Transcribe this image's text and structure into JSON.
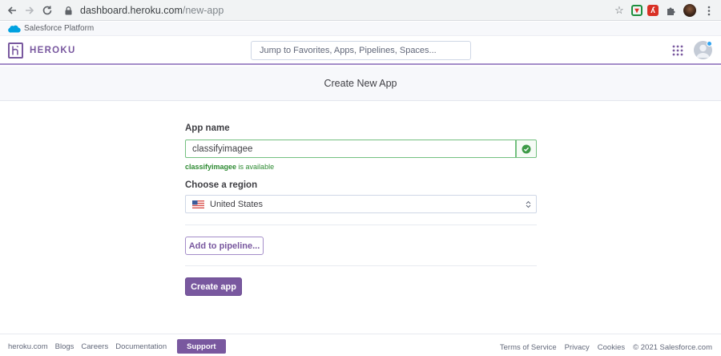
{
  "browser": {
    "url_host": "dashboard.heroku.com",
    "url_path": "/new-app"
  },
  "platform_bar": {
    "label": "Salesforce Platform"
  },
  "header": {
    "brand": "HEROKU",
    "search_placeholder": "Jump to Favorites, Apps, Pipelines, Spaces..."
  },
  "subheader": {
    "title": "Create New App"
  },
  "form": {
    "app_name_label": "App name",
    "app_name_value": "classifyimagee",
    "availability_name": "classifyimagee",
    "availability_suffix": " is available",
    "region_label": "Choose a region",
    "region_value": "United States",
    "pipeline_button": "Add to pipeline...",
    "create_button": "Create app"
  },
  "footer": {
    "left_links": [
      "heroku.com",
      "Blogs",
      "Careers",
      "Documentation"
    ],
    "support": "Support",
    "right_links": [
      "Terms of Service",
      "Privacy",
      "Cookies",
      "© 2021 Salesforce.com"
    ]
  },
  "colors": {
    "brand_purple": "#79589f",
    "success_green": "#2e8b33",
    "notification_blue": "#2ea3f2"
  },
  "icons": [
    "back-arrow-icon",
    "forward-arrow-icon",
    "reload-icon",
    "lock-icon",
    "star-icon",
    "extension-pocket-icon",
    "extension-pdf-icon",
    "puzzle-icon",
    "profile-icon",
    "menu-dots-icon",
    "salesforce-cloud-icon",
    "heroku-logo-icon",
    "apps-grid-icon",
    "user-avatar-icon",
    "check-circle-icon",
    "us-flag-icon",
    "select-arrows-icon"
  ]
}
